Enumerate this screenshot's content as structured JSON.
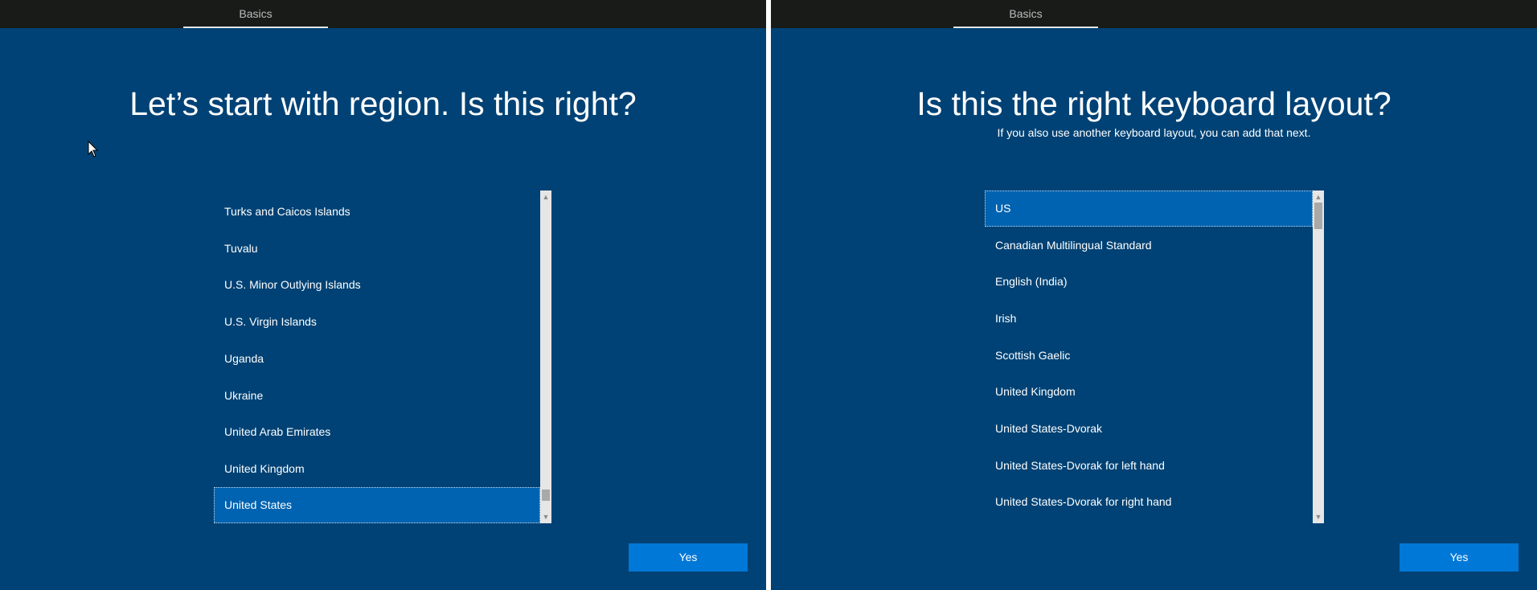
{
  "left": {
    "tab": "Basics",
    "title": "Let’s start with region. Is this right?",
    "items": [
      {
        "label": "Turks and Caicos Islands"
      },
      {
        "label": "Tuvalu"
      },
      {
        "label": "U.S. Minor Outlying Islands"
      },
      {
        "label": "U.S. Virgin Islands"
      },
      {
        "label": "Uganda"
      },
      {
        "label": "Ukraine"
      },
      {
        "label": "United Arab Emirates"
      },
      {
        "label": "United Kingdom"
      },
      {
        "label": "United States"
      }
    ],
    "selected_label": "United States",
    "yes_label": "Yes",
    "scroll_position": 0.95
  },
  "right": {
    "tab": "Basics",
    "title": "Is this the right keyboard layout?",
    "subtitle": "If you also use another keyboard layout, you can add that next.",
    "items": [
      {
        "label": "US"
      },
      {
        "label": "Canadian Multilingual Standard"
      },
      {
        "label": "English (India)"
      },
      {
        "label": "Irish"
      },
      {
        "label": "Scottish Gaelic"
      },
      {
        "label": "United Kingdom"
      },
      {
        "label": "United States-Dvorak"
      },
      {
        "label": "United States-Dvorak for left hand"
      },
      {
        "label": "United States-Dvorak for right hand"
      }
    ],
    "selected_label": "US",
    "yes_label": "Yes",
    "scroll_position": 0.0
  },
  "icons": {
    "scroll_up": "chevron-up-icon",
    "scroll_down": "chevron-down-icon",
    "cursor": "mouse-pointer-icon"
  },
  "colors": {
    "background": "#004275",
    "selected": "#0063b1",
    "button": "#0078d7",
    "topbar": "#181b18"
  }
}
